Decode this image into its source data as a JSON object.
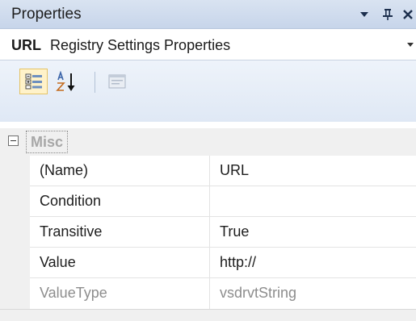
{
  "panel": {
    "title": "Properties"
  },
  "object": {
    "name": "URL",
    "type": "Registry Settings Properties"
  },
  "toolbar": {
    "categorized_icon": "categorized-icon",
    "alphabetical_icon": "alphabetical-sort-icon",
    "property_pages_icon": "property-pages-icon"
  },
  "category": {
    "label": "Misc",
    "expanded": true
  },
  "properties": [
    {
      "name": "(Name)",
      "value": "URL"
    },
    {
      "name": "Condition",
      "value": ""
    },
    {
      "name": "Transitive",
      "value": "True"
    },
    {
      "name": "Value",
      "value": "http://"
    },
    {
      "name": "ValueType",
      "value": "vsdrvtString"
    }
  ],
  "colors": {
    "title_bar": "#c7d5ea",
    "toolbar": "#dfe8f5",
    "active_button": "#fff2c9",
    "category_text": "#a7a7a7",
    "readonly_text": "#8d8d8d"
  }
}
